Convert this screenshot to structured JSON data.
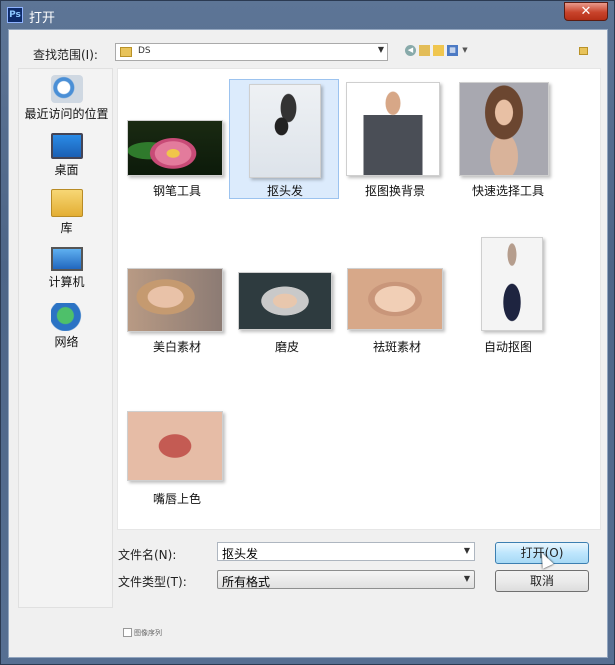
{
  "window": {
    "title": "打开",
    "app_icon": "Ps",
    "close_glyph": "✕"
  },
  "toolbar": {
    "lookin_label": "查找范围(I):",
    "lookin_value": "DS",
    "icons": [
      "back-icon",
      "up-folder-icon",
      "new-folder-icon",
      "view-menu-icon"
    ]
  },
  "places": [
    {
      "label": "最近访问的位置",
      "icon": "recent-places-icon"
    },
    {
      "label": "桌面",
      "icon": "desktop-icon"
    },
    {
      "label": "库",
      "icon": "libraries-icon"
    },
    {
      "label": "计算机",
      "icon": "computer-icon"
    },
    {
      "label": "网络",
      "icon": "network-icon"
    }
  ],
  "files": [
    {
      "name": "钢笔工具",
      "selected": false
    },
    {
      "name": "抠头发",
      "selected": true
    },
    {
      "name": "抠图换背景",
      "selected": false
    },
    {
      "name": "快速选择工具",
      "selected": false
    },
    {
      "name": "美白素材",
      "selected": false
    },
    {
      "name": "磨皮",
      "selected": false
    },
    {
      "name": "祛斑素材",
      "selected": false
    },
    {
      "name": "自动抠图",
      "selected": false
    },
    {
      "name": "嘴唇上色",
      "selected": false
    }
  ],
  "form": {
    "filename_label": "文件名(N):",
    "filename_value": "抠头发",
    "filetype_label": "文件类型(T):",
    "filetype_value": "所有格式"
  },
  "buttons": {
    "open": "打开(O)",
    "cancel": "取消"
  },
  "image_sequence_label": "图像序列",
  "colors": {
    "titlebar": "#566f92",
    "selection": "#dcebfc",
    "close": "#c8432b"
  }
}
